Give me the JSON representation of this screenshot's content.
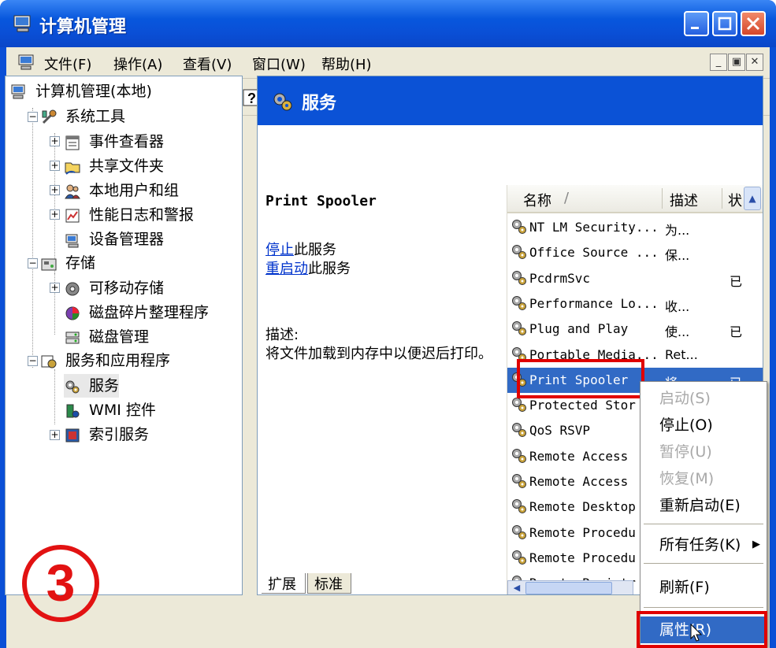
{
  "window": {
    "title": "计算机管理"
  },
  "menu": {
    "items": [
      "文件(F)",
      "操作(A)",
      "查看(V)",
      "窗口(W)",
      "帮助(H)"
    ],
    "mdi_min": "_",
    "mdi_restore": "▣",
    "mdi_close": "✕"
  },
  "toolbar": {
    "icons": [
      "back-arrow-icon",
      "forward-arrow-icon",
      "up-folder-icon",
      "show-tree-icon",
      "properties-icon",
      "refresh-icon",
      "export-list-icon",
      "help-icon",
      "console-icon",
      "play-icon",
      "stop-icon",
      "pause-icon",
      "restart-icon"
    ]
  },
  "tree": {
    "root": "计算机管理(本地)",
    "system_tools": "系统工具",
    "event_viewer": "事件查看器",
    "shared_folders": "共享文件夹",
    "local_users": "本地用户和组",
    "perf_logs": "性能日志和警报",
    "device_manager": "设备管理器",
    "storage": "存储",
    "removable_storage": "可移动存储",
    "defrag": "磁盘碎片整理程序",
    "disk_mgmt": "磁盘管理",
    "services_apps": "服务和应用程序",
    "services": "服务",
    "wmi": "WMI 控件",
    "indexing": "索引服务"
  },
  "annotation": {
    "step_number": "3"
  },
  "services_pane": {
    "header_title": "服务",
    "selected_name": "Print Spooler",
    "stop_link": "停止",
    "stop_suffix": "此服务",
    "restart_link": "重启动",
    "restart_suffix": "此服务",
    "desc_label": "描述:",
    "desc_text": "将文件加载到内存中以便迟后打印。"
  },
  "list": {
    "col_name": "名称",
    "col_sort": "/",
    "col_desc": "描述",
    "col_status": "状",
    "rows": [
      {
        "name": "NT LM Security...",
        "desc": "为...",
        "status": ""
      },
      {
        "name": "Office Source ...",
        "desc": "保...",
        "status": ""
      },
      {
        "name": "PcdrmSvc",
        "desc": "",
        "status": "已"
      },
      {
        "name": "Performance Lo...",
        "desc": "收...",
        "status": ""
      },
      {
        "name": "Plug and Play",
        "desc": "使...",
        "status": "已"
      },
      {
        "name": "Portable Media...",
        "desc": "Ret...",
        "status": ""
      },
      {
        "name": "Print Spooler",
        "desc": "将",
        "status": "已"
      },
      {
        "name": "Protected Stor",
        "desc": "",
        "status": ""
      },
      {
        "name": "QoS RSVP",
        "desc": "",
        "status": ""
      },
      {
        "name": "Remote Access",
        "desc": "",
        "status": ""
      },
      {
        "name": "Remote Access",
        "desc": "",
        "status": ""
      },
      {
        "name": "Remote Desktop",
        "desc": "",
        "status": ""
      },
      {
        "name": "Remote Procedu",
        "desc": "",
        "status": ""
      },
      {
        "name": "Remote Procedu",
        "desc": "",
        "status": ""
      },
      {
        "name": "Remote Registr",
        "desc": "",
        "status": ""
      }
    ]
  },
  "tabs": {
    "extended": "扩展",
    "standard": "标准"
  },
  "context_menu": {
    "start": "启动(S)",
    "stop": "停止(O)",
    "pause": "暂停(U)",
    "resume": "恢复(M)",
    "restart": "重新启动(E)",
    "all_tasks": "所有任务(K)",
    "refresh": "刷新(F)",
    "properties": "属性(R)"
  },
  "colors": {
    "title_blue": "#0a4fd6",
    "selection_blue": "#316ac5",
    "highlight_red": "#e00000",
    "link_blue": "#0033cc"
  }
}
